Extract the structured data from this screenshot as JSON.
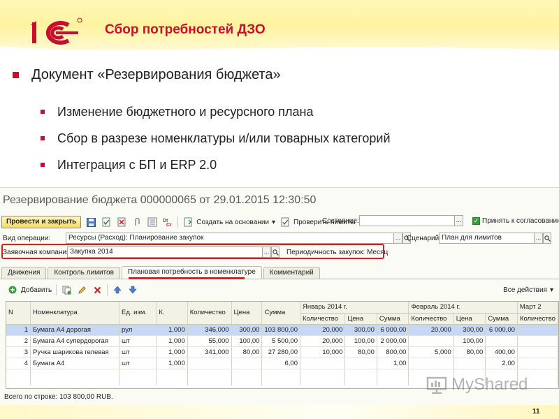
{
  "slide": {
    "title": "Сбор потребностей ДЗО",
    "bullet": "Документ «Резервирования  бюджета»",
    "sub_bullets": [
      "Изменение бюджетного и ресурсного плана",
      "Сбор в разрезе номенклатуры и/или товарных категорий",
      "Интеграция с БП и ERP 2.0"
    ],
    "page_number": "11",
    "watermark": "MyShared"
  },
  "colors": {
    "accent_red": "#c8102e",
    "highlight_red": "#d81e1e",
    "selection_blue": "#c6d8f4",
    "banner_yellow": "#fff3a0"
  },
  "window": {
    "title": "Резервирование бюджета 000000065 от 29.01.2015 12:30:50",
    "toolbar": {
      "post_close": "Провести и закрыть",
      "create_based": "Создать на основании",
      "check_limits": "Проверить лимиты",
      "state_label": "Состояние:",
      "state_value": "",
      "approve_label": "Принять к согласованию"
    },
    "fields": {
      "operation_label": "Вид операции:",
      "operation_value": "Ресурсы (Расход): Планирование закупок",
      "scenario_label": "Сценарий:",
      "scenario_value": "План для лимитов",
      "campaign_label": "Заявочная компания:",
      "campaign_value": "Закупка 2014",
      "periodicity": "Периодичность закупок: Месяц"
    },
    "tabs": [
      "Движения",
      "Контроль лимитов",
      "Плановая потребность в номенклатуре",
      "Комментарий"
    ],
    "subtoolbar": {
      "add": "Добавить",
      "all_actions": "Все действия"
    },
    "table": {
      "headers": [
        "N",
        "Номенклатура",
        "Ед. изм.",
        "К.",
        "Количество",
        "Цена",
        "Сумма"
      ],
      "months": [
        "Январь 2014 г.",
        "Февраль 2014 г.",
        "Март 2"
      ],
      "month_sub": [
        "Количество",
        "Цена",
        "Сумма"
      ],
      "rows": [
        [
          "1",
          "Бумага А4 дорогая",
          "рул",
          "1,000",
          "346,000",
          "300,00",
          "103 800,00",
          "20,000",
          "300,00",
          "6 000,00",
          "20,000",
          "300,00",
          "6 000,00",
          ""
        ],
        [
          "2",
          "Бумага А4 супердорогая",
          "шт",
          "1,000",
          "55,000",
          "100,00",
          "5 500,00",
          "20,000",
          "100,00",
          "2 000,00",
          "",
          "100,00",
          "",
          ""
        ],
        [
          "3",
          "Ручка шарикова гелевая",
          "шт",
          "1,000",
          "341,000",
          "80,00",
          "27 280,00",
          "10,000",
          "80,00",
          "800,00",
          "5,000",
          "80,00",
          "400,00",
          ""
        ],
        [
          "4",
          "Бумага А4",
          "шт",
          "1,000",
          "",
          "",
          "6,00",
          "",
          "",
          "1,00",
          "",
          "",
          "2,00",
          ""
        ]
      ]
    },
    "footer": "Всего по строке: 103 800,00 RUB."
  }
}
